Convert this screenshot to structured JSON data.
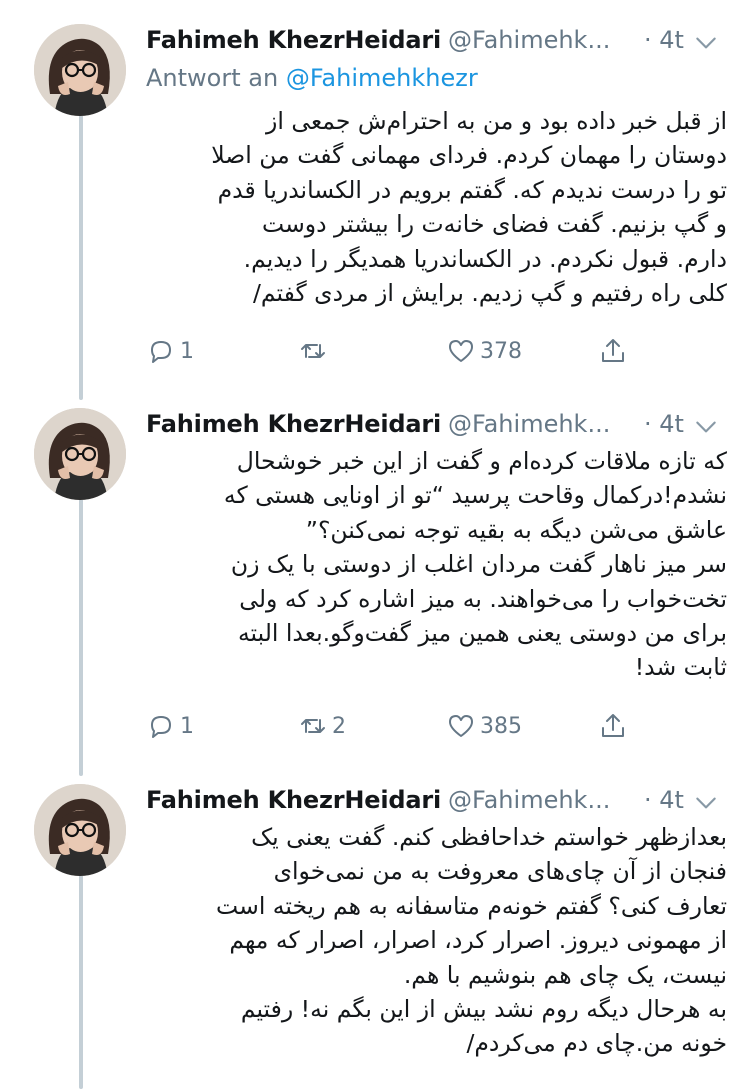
{
  "tweets": [
    {
      "name": "Fahimeh KhezrHeidari",
      "handle": "@Fahimehk...",
      "time": "· 4t",
      "reply_prefix": "Antwort an",
      "reply_handle": "@Fahimehkhezr",
      "text": "از قبل خبر داده بود و من به احترام‌ش جمعی از\nدوستان را مهمان کردم. فردای مهمانی گفت من اصلا\nتو را درست ندیدم که. گفتم برویم در الکساندریا قدم\nو گپ بزنیم. گفت فضای خانه‌ت را بیشتر دوست\nدارم. قبول نکردم. در الکساندریا همدیگر را دیدیم.\nکلی راه رفتیم و گپ زدیم. برایش از مردی گفتم/",
      "reply_count": "1",
      "retweet_count": "",
      "like_count": "378"
    },
    {
      "name": "Fahimeh KhezrHeidari",
      "handle": "@Fahimehk...",
      "time": "· 4t",
      "text": "که تازه ملاقات کرده‌ام و گفت از این خبر خوشحال\nنشدم!درکمال وقاحت پرسید “تو از اونایی هستی که\nعاشق می‌شن دیگه به بقیه توجه نمی‌کنن؟”\nسر میز ناهار گفت مردان اغلب از دوستی با یک زن\nتخت‌خواب را می‌خواهند. به میز اشاره کرد که ولی\nبرای من دوستی یعنی همین میز گفت‌وگو.بعدا البته\nثابت شد!",
      "reply_count": "1",
      "retweet_count": "2",
      "like_count": "385"
    },
    {
      "name": "Fahimeh KhezrHeidari",
      "handle": "@Fahimehk...",
      "time": "· 4t",
      "text": "بعدازظهر خواستم خداحافظی کنم. گفت یعنی یک\nفنجان از آن چای‌های معروفت به من نمی‌خوای\nتعارف کنی؟ گفتم خونه‌م متاسفانه به هم ریخته است\nاز مهمونی دیروز. اصرار کرد، اصرار، اصرار که مهم\nنیست، یک چای هم بنوشیم با هم.\nبه هرحال دیگه روم نشد بیش از این بگم نه! رفتیم\nخونه من.چای دم می‌کردم/",
      "reply_count": "",
      "retweet_count": "",
      "like_count": ""
    }
  ],
  "colors": {
    "muted": "#657786",
    "link": "#1b95e0",
    "thread_line": "#c4cfd6"
  },
  "icons": [
    "reply-icon",
    "retweet-icon",
    "like-icon",
    "share-icon",
    "chevron-down-icon"
  ]
}
